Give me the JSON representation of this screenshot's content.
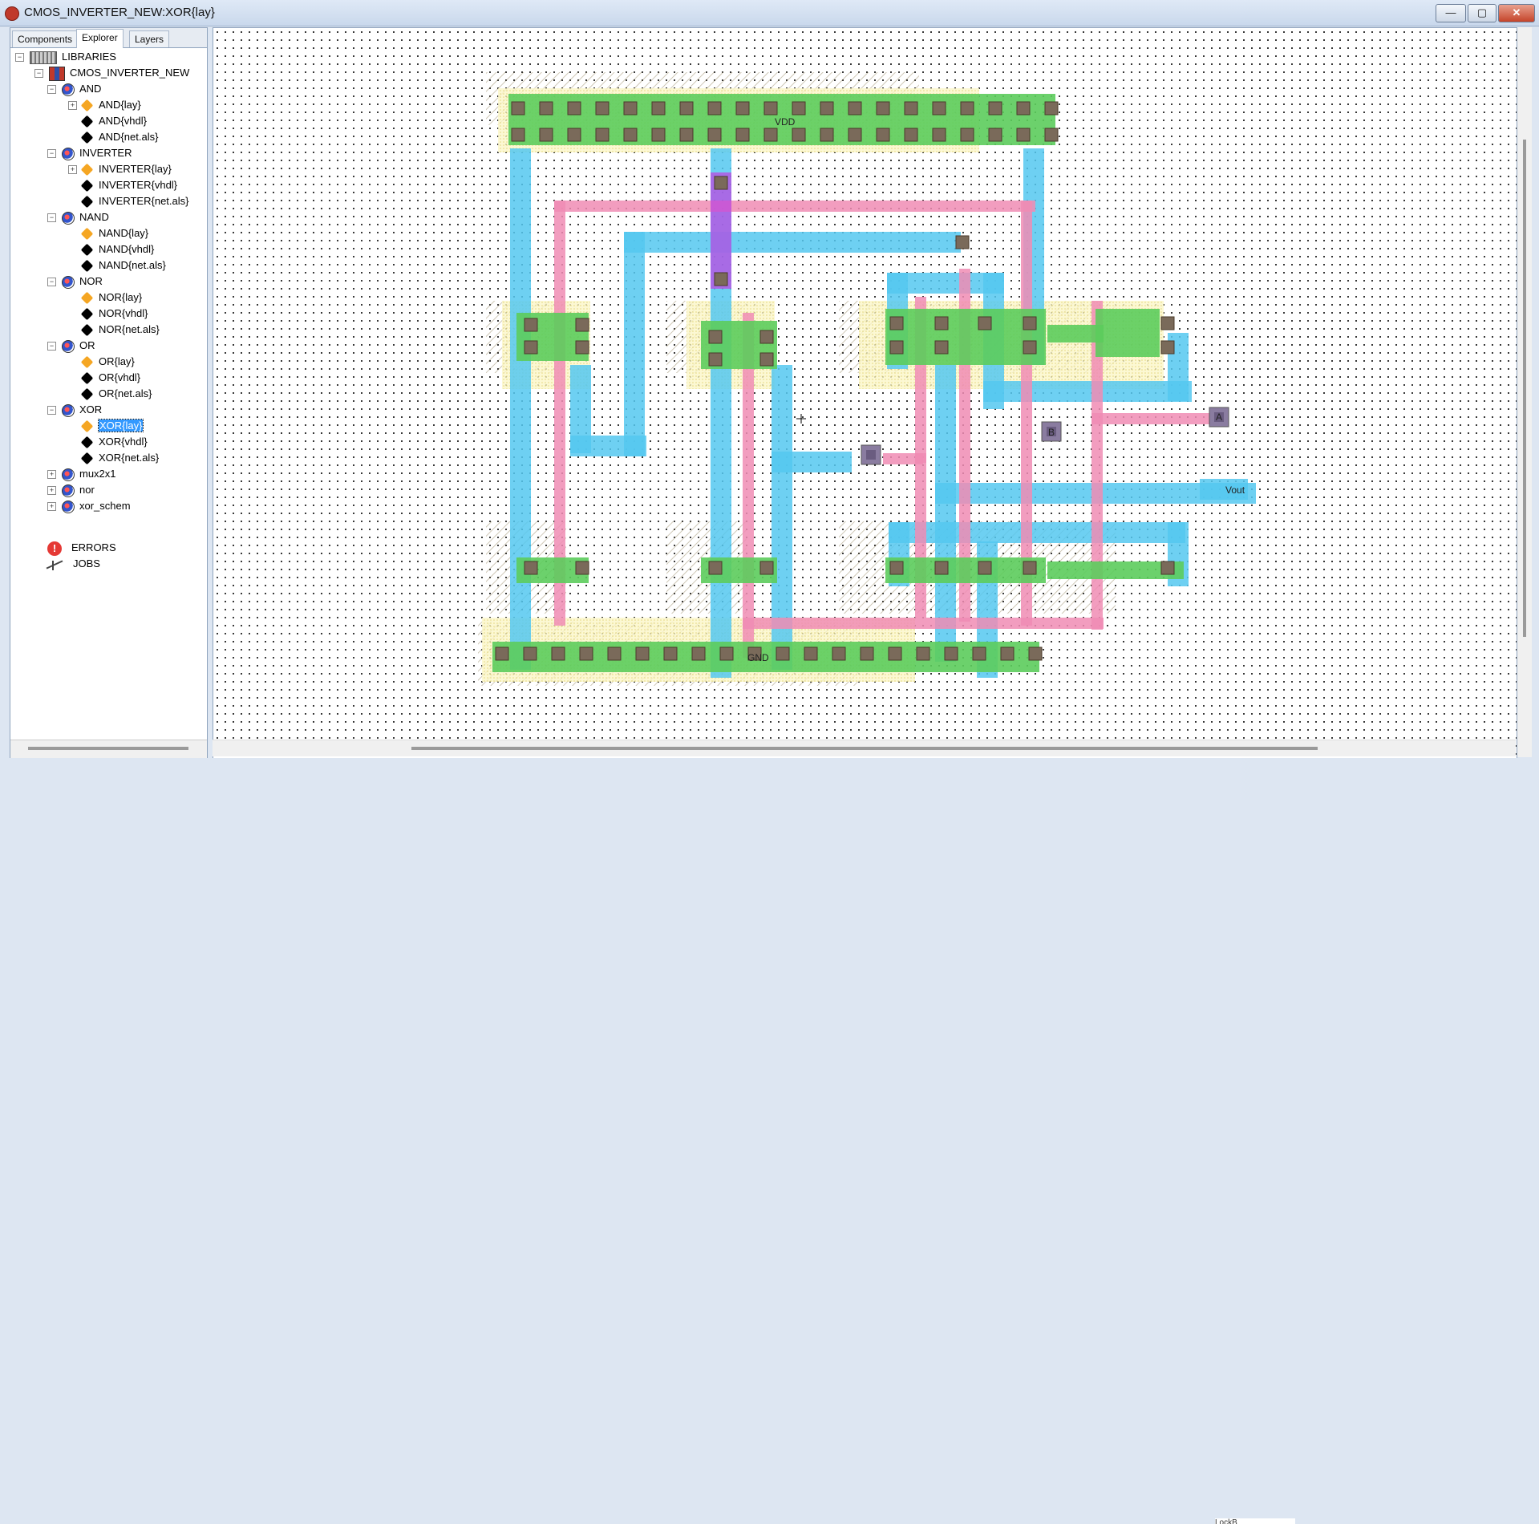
{
  "window": {
    "title": "CMOS_INVERTER_NEW:XOR{lay}",
    "min_label": "—",
    "max_label": "▢",
    "close_label": "✕"
  },
  "tabs": [
    {
      "label": "Components"
    },
    {
      "label": "Explorer"
    },
    {
      "label": "Layers"
    }
  ],
  "tree": {
    "root": "LIBRARIES",
    "library": "CMOS_INVERTER_NEW",
    "cells": [
      {
        "name": "AND",
        "views": [
          "AND{lay}",
          "AND{vhdl}",
          "AND{net.als}"
        ]
      },
      {
        "name": "INVERTER",
        "views": [
          "INVERTER{lay}",
          "INVERTER{vhdl}",
          "INVERTER{net.als}"
        ]
      },
      {
        "name": "NAND",
        "views": [
          "NAND{lay}",
          "NAND{vhdl}",
          "NAND{net.als}"
        ]
      },
      {
        "name": "NOR",
        "views": [
          "NOR{lay}",
          "NOR{vhdl}",
          "NOR{net.als}"
        ]
      },
      {
        "name": "OR",
        "views": [
          "OR{lay}",
          "OR{vhdl}",
          "OR{net.als}"
        ]
      },
      {
        "name": "XOR",
        "views": [
          "XOR{lay}",
          "XOR{vhdl}",
          "XOR{net.als}"
        ]
      }
    ],
    "other_cells": [
      "mux2x1",
      "nor",
      "xor_schem"
    ],
    "errors": "ERRORS",
    "jobs": "JOBS",
    "selected": "XOR{lay}"
  },
  "layout": {
    "labels": {
      "vdd": "VDD",
      "gnd": "GND",
      "a": "A",
      "b": "B",
      "vout": "Vout"
    },
    "colors": {
      "metal": "#55c8f0",
      "poly": "#f08cb4",
      "active": "#5ccc5c",
      "implant": "#f5f0a0",
      "contact": "#7a6a5a",
      "via": "#c040e0",
      "pin": "#8a7ca0"
    }
  },
  "status": {
    "coord": "LockB"
  }
}
